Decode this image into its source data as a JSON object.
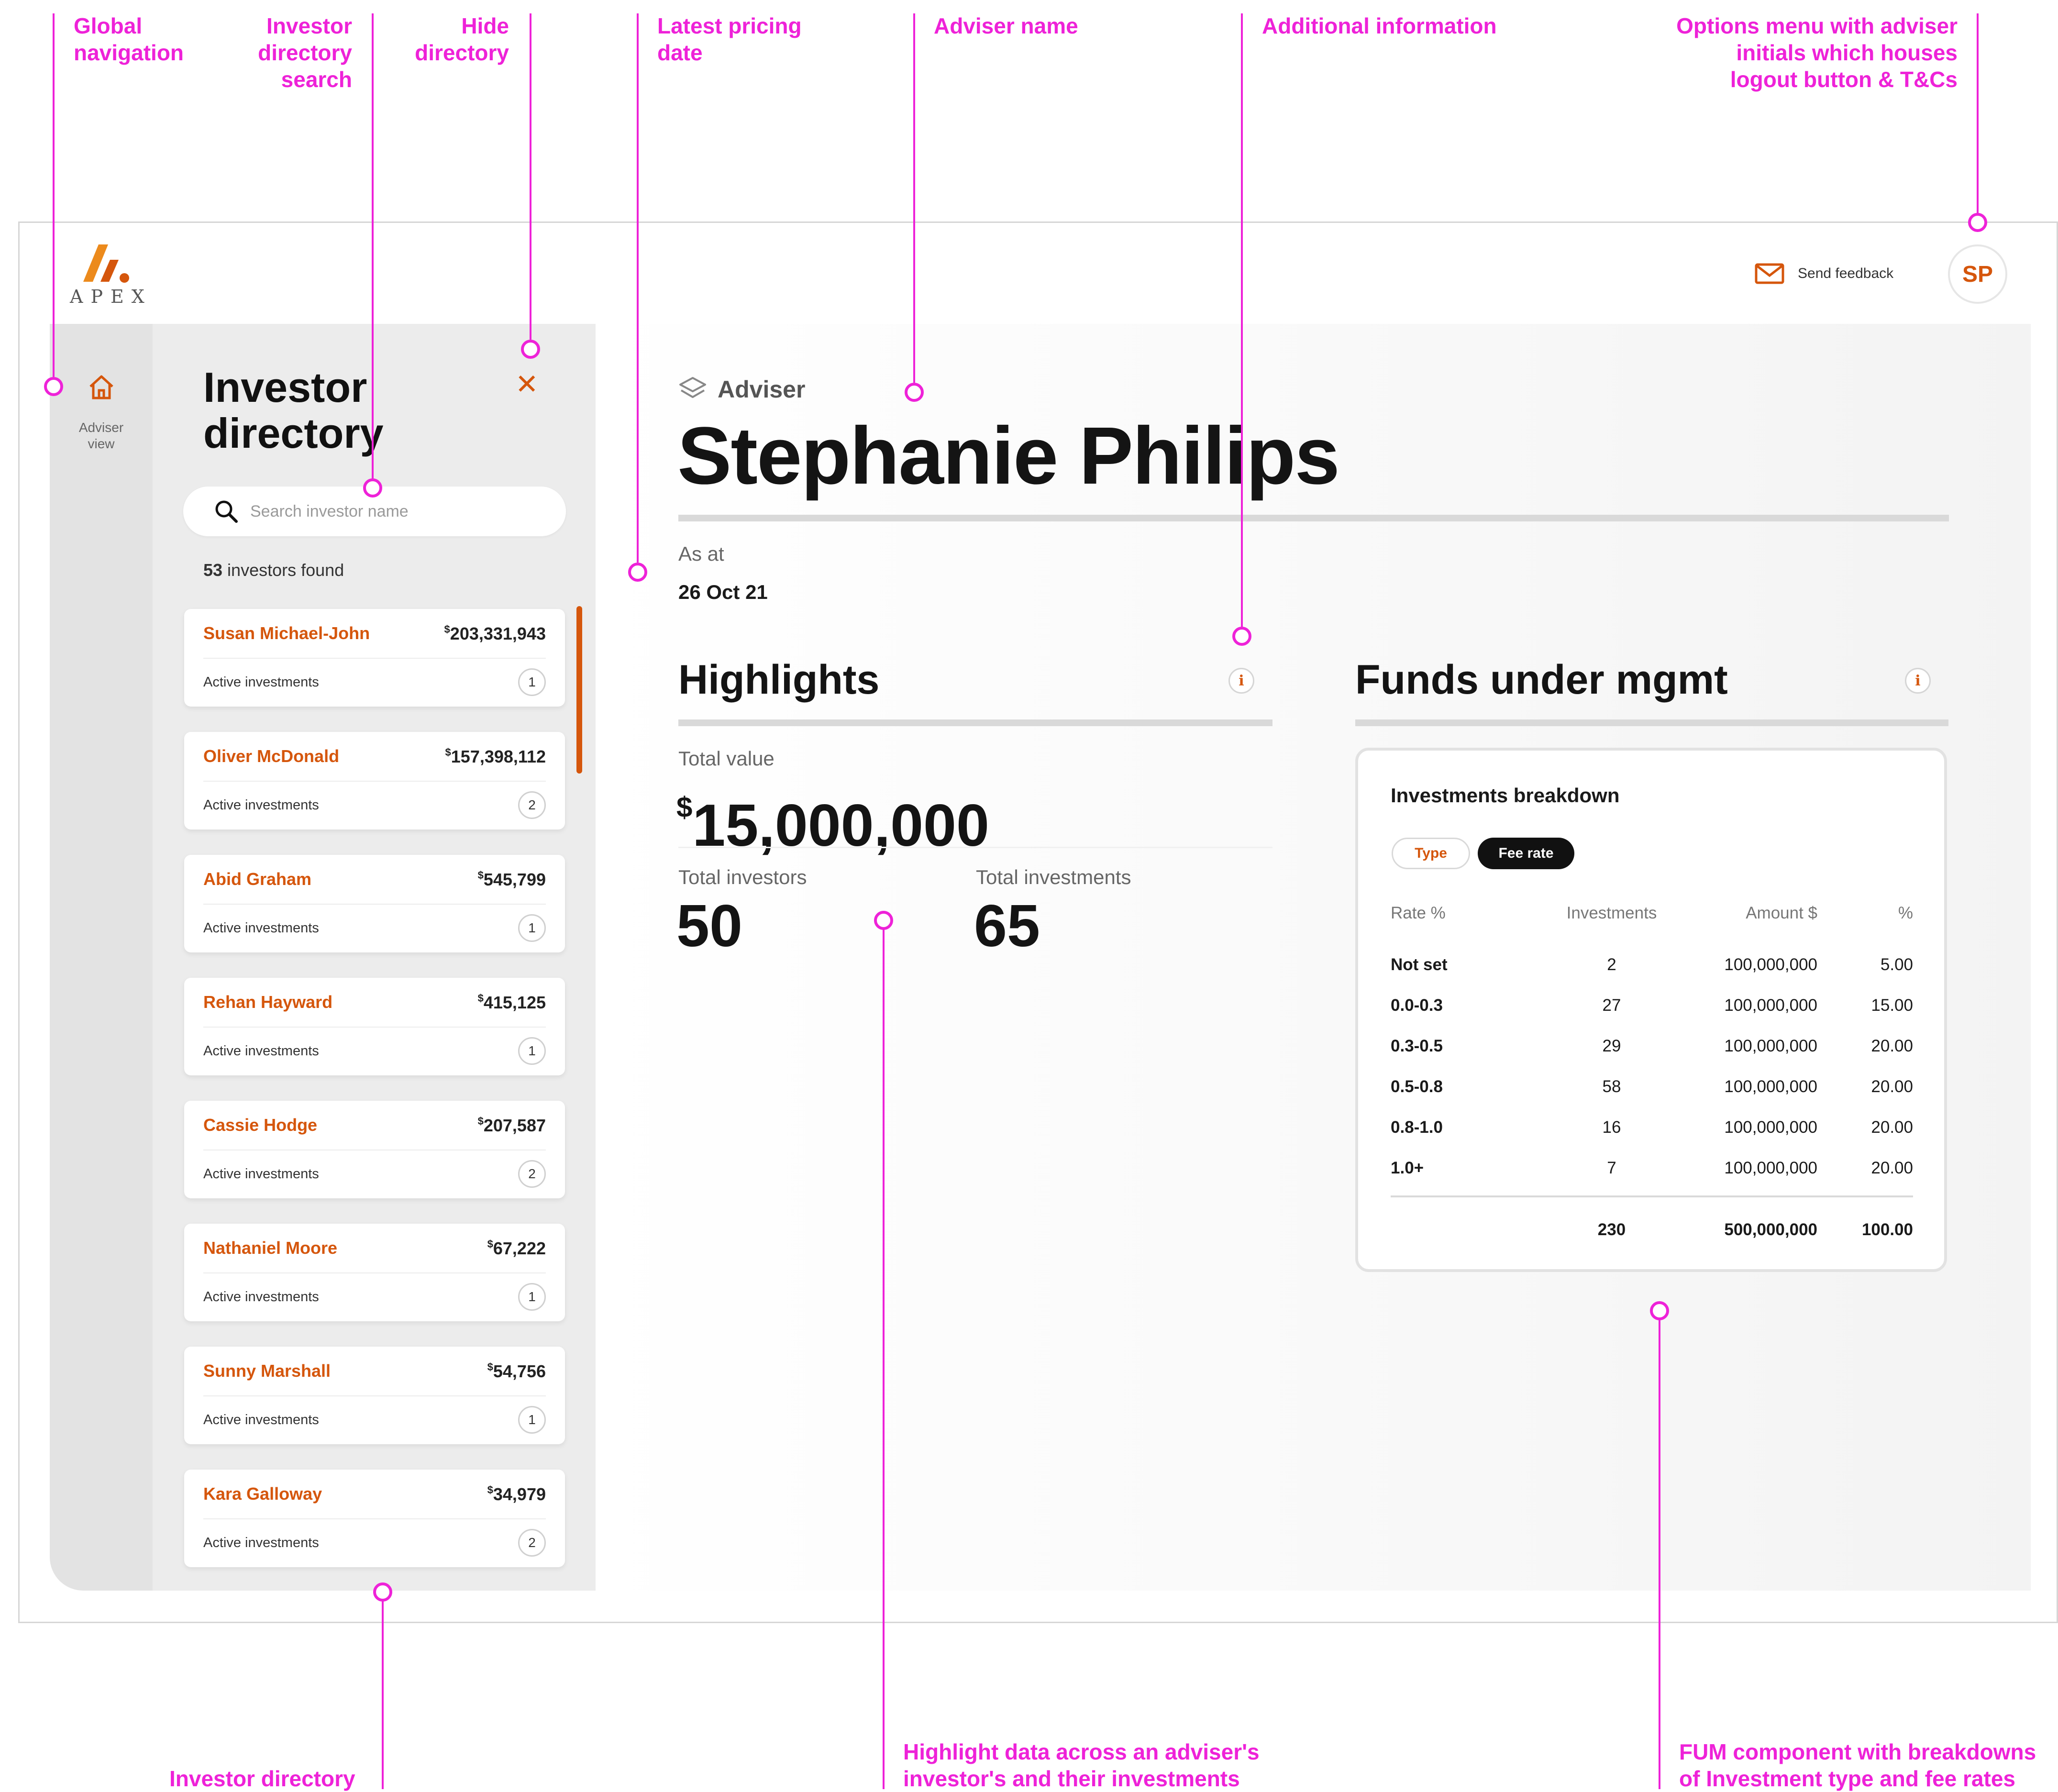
{
  "annotations": {
    "global_navigation": "Global\nnavigation",
    "investor_directory_search": "Investor\ndirectory\nsearch",
    "hide_directory": "Hide\ndirectory",
    "latest_pricing_date": "Latest pricing\ndate",
    "adviser_name": "Adviser name",
    "additional_information": "Additional information",
    "options_menu": "Options menu with adviser\ninitials which houses\nlogout button & T&Cs",
    "investor_directory": "Investor directory",
    "highlight_data": "Highlight data across an adviser's\ninvestor's and their investments",
    "fum_component": "FUM component with breakdowns\nof Investment type and fee rates"
  },
  "brand": {
    "name": "APEX",
    "accent": "#d5560c",
    "annotation_color": "#ee22d8"
  },
  "header": {
    "feedback_label": "Send feedback",
    "avatar_initials": "SP"
  },
  "nav": {
    "home_label": "Adviser\nview"
  },
  "directory": {
    "title": "Investor\ndirectory",
    "search_placeholder": "Search investor name",
    "found_count": "53",
    "found_suffix": " investors found",
    "investors": [
      {
        "name": "Susan Michael-John",
        "currency": "$",
        "amount": "203,331,943",
        "label": "Active investments",
        "count": "1"
      },
      {
        "name": "Oliver McDonald",
        "currency": "$",
        "amount": "157,398,112",
        "label": "Active investments",
        "count": "2"
      },
      {
        "name": "Abid Graham",
        "currency": "$",
        "amount": "545,799",
        "label": "Active investments",
        "count": "1"
      },
      {
        "name": "Rehan Hayward",
        "currency": "$",
        "amount": "415,125",
        "label": "Active investments",
        "count": "1"
      },
      {
        "name": "Cassie Hodge",
        "currency": "$",
        "amount": "207,587",
        "label": "Active investments",
        "count": "2"
      },
      {
        "name": "Nathaniel Moore",
        "currency": "$",
        "amount": "67,222",
        "label": "Active investments",
        "count": "1"
      },
      {
        "name": "Sunny Marshall",
        "currency": "$",
        "amount": "54,756",
        "label": "Active investments",
        "count": "1"
      },
      {
        "name": "Kara Galloway",
        "currency": "$",
        "amount": "34,979",
        "label": "Active investments",
        "count": "2"
      }
    ]
  },
  "adviser": {
    "kicker": "Adviser",
    "name": "Stephanie Philips",
    "as_at_label": "As at",
    "as_at_value": "26 Oct 21"
  },
  "highlights": {
    "title": "Highlights",
    "total_value_label": "Total value",
    "total_value_currency": "$",
    "total_value": "15,000,000",
    "total_investors_label": "Total investors",
    "total_investors": "50",
    "total_investments_label": "Total investments",
    "total_investments": "65"
  },
  "fum": {
    "title": "Funds under mgmt",
    "card_title": "Investments breakdown",
    "tab_type": "Type",
    "tab_fee": "Fee rate",
    "columns": [
      "Rate %",
      "Investments",
      "Amount $",
      "%"
    ],
    "rows": [
      [
        "Not set",
        "2",
        "100,000,000",
        "5.00"
      ],
      [
        "0.0-0.3",
        "27",
        "100,000,000",
        "15.00"
      ],
      [
        "0.3-0.5",
        "29",
        "100,000,000",
        "20.00"
      ],
      [
        "0.5-0.8",
        "58",
        "100,000,000",
        "20.00"
      ],
      [
        "0.8-1.0",
        "16",
        "100,000,000",
        "20.00"
      ],
      [
        "1.0+",
        "7",
        "100,000,000",
        "20.00"
      ]
    ],
    "totals": [
      "",
      "230",
      "500,000,000",
      "100.00"
    ]
  },
  "icons": {
    "home": "home-icon",
    "search": "search-icon",
    "close": "close-icon",
    "mail": "mail-icon",
    "layers": "layers-icon",
    "info": "info-icon"
  }
}
